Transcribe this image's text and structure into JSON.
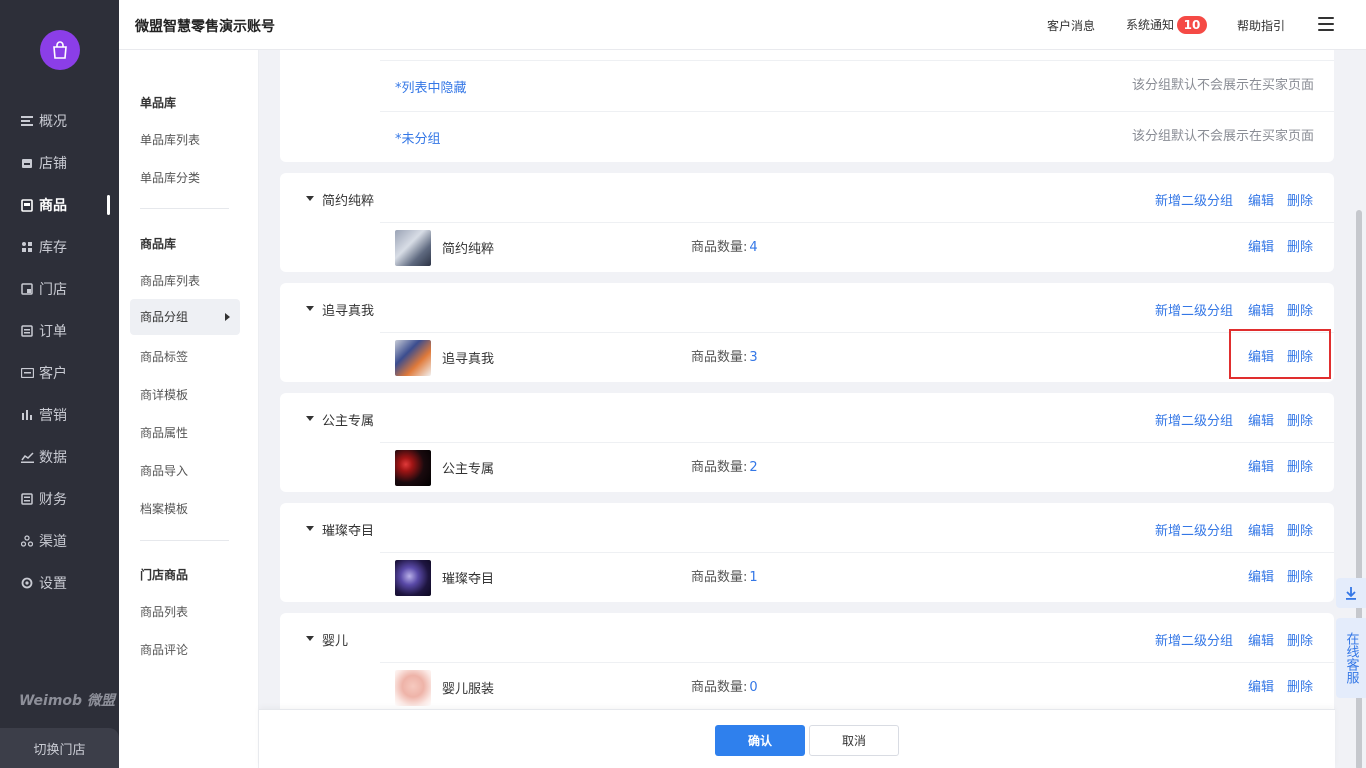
{
  "app": {
    "title": "微盟智慧零售演示账号",
    "brand": "Weimob 微盟",
    "switch_store": "切换门店"
  },
  "header": {
    "customer_msg": "客户消息",
    "notice": "系统通知",
    "notice_count": "10",
    "help": "帮助指引"
  },
  "nav": [
    {
      "label": "概况",
      "icon": "list-icon"
    },
    {
      "label": "店铺",
      "icon": "store-icon"
    },
    {
      "label": "商品",
      "icon": "product-icon",
      "active": true
    },
    {
      "label": "库存",
      "icon": "inventory-icon"
    },
    {
      "label": "门店",
      "icon": "shop-icon"
    },
    {
      "label": "订单",
      "icon": "order-icon"
    },
    {
      "label": "客户",
      "icon": "customer-icon"
    },
    {
      "label": "营销",
      "icon": "marketing-icon"
    },
    {
      "label": "数据",
      "icon": "chart-icon"
    },
    {
      "label": "财务",
      "icon": "finance-icon"
    },
    {
      "label": "渠道",
      "icon": "channel-icon"
    },
    {
      "label": "设置",
      "icon": "gear-icon"
    }
  ],
  "subnav": {
    "g1": "单品库",
    "g1_items": [
      "单品库列表",
      "单品库分类"
    ],
    "g2": "商品库",
    "g2_items": [
      "商品库列表",
      "商品分组",
      "商品标签",
      "商详模板",
      "商品属性",
      "商品导入",
      "档案模板"
    ],
    "g3": "门店商品",
    "g3_items": [
      "商品列表",
      "商品评论"
    ]
  },
  "special_rows": [
    {
      "name": "*列表中隐藏",
      "desc": "该分组默认不会展示在买家页面"
    },
    {
      "name": "*未分组",
      "desc": "该分组默认不会展示在买家页面"
    }
  ],
  "labels": {
    "add_sub": "新增二级分组",
    "edit": "编辑",
    "delete": "删除",
    "count_label": "商品数量:"
  },
  "groups": [
    {
      "name": "简约纯粹",
      "child": "简约纯粹",
      "count": "4"
    },
    {
      "name": "追寻真我",
      "child": "追寻真我",
      "count": "3"
    },
    {
      "name": "公主专属",
      "child": "公主专属",
      "count": "2"
    },
    {
      "name": "璀璨夺目",
      "child": "璀璨夺目",
      "count": "1"
    },
    {
      "name": "婴儿",
      "child": "婴儿服装",
      "count": "0"
    }
  ],
  "side_tools": {
    "online_service": "在线客服"
  },
  "footer": {
    "confirm": "确认",
    "cancel": "取消"
  },
  "colors": {
    "accent": "#3477e6",
    "sidebar": "#2d2f39",
    "badge": "#f54a45",
    "highlight": "#e02e2e"
  }
}
